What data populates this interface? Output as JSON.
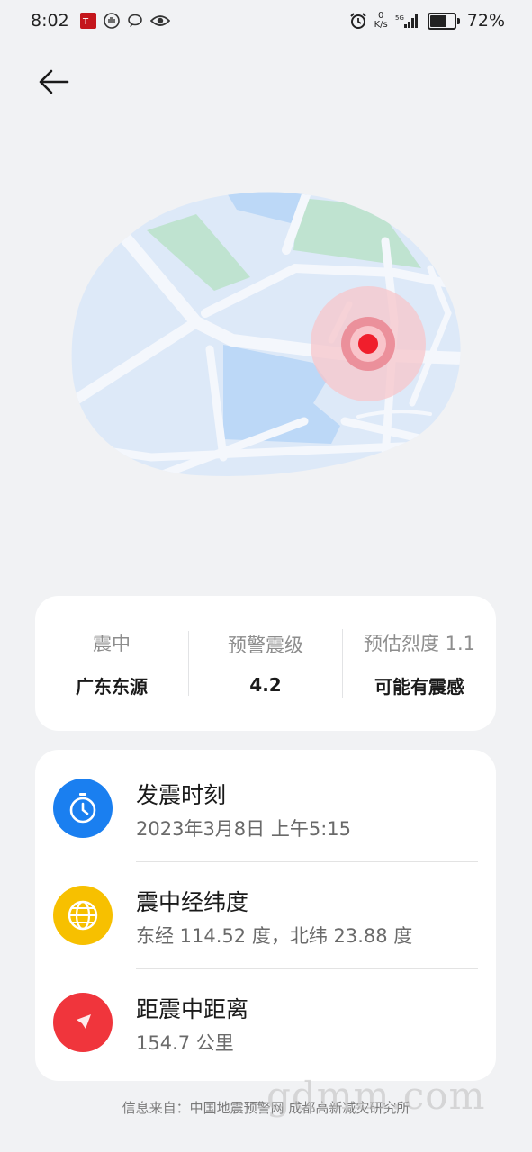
{
  "status_bar": {
    "time": "8:02",
    "net_speed_value": "0",
    "net_speed_unit": "K/s",
    "signal_label": "5G",
    "battery_percent": "72%",
    "battery_level": 0.72
  },
  "summary": {
    "epicenter_label": "震中",
    "epicenter_value": "广东东源",
    "magnitude_label": "预警震级",
    "magnitude_value": "4.2",
    "intensity_label": "预估烈度 1.1",
    "intensity_value": "可能有震感"
  },
  "details": {
    "time": {
      "title": "发震时刻",
      "value": "2023年3月8日 上午5:15",
      "icon": "clock-icon",
      "color": "#1a7ff0"
    },
    "coords": {
      "title": "震中经纬度",
      "value": "东经 114.52 度，北纬 23.88 度",
      "icon": "globe-icon",
      "color": "#f7c000"
    },
    "distance": {
      "title": "距震中距离",
      "value": "154.7 公里",
      "icon": "navigation-icon",
      "color": "#f0353c"
    }
  },
  "source": "信息来自：中国地震预警网 成都高新减灾研究所",
  "watermark": "gdmm.com",
  "colors": {
    "background": "#f1f2f4",
    "card": "#ffffff",
    "map_land": "#dde9f8",
    "map_water": "#bcd8f7",
    "map_park": "#bfe3d0",
    "epicenter": "#f01e2c"
  }
}
